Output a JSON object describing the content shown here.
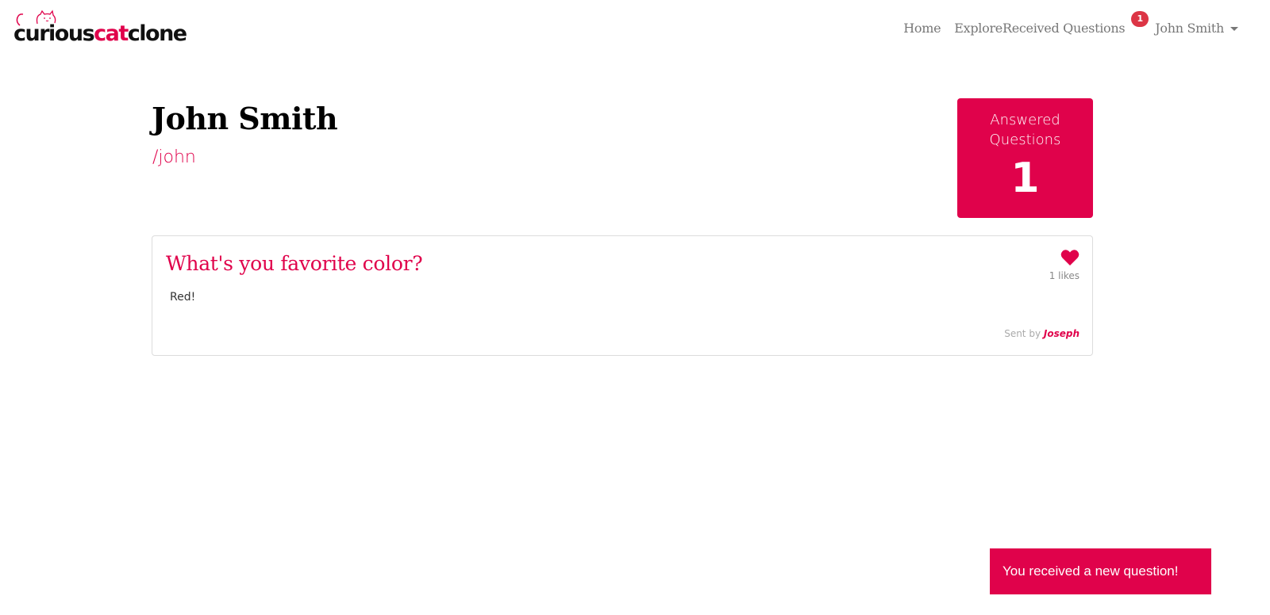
{
  "brand": {
    "part1": "curious",
    "part2": "cat",
    "part3": "clone",
    "accent_color": "#e0024b"
  },
  "nav": {
    "home": "Home",
    "explore": "Explore",
    "received_questions": "Received Questions",
    "received_badge": "1",
    "user_name": "John Smith"
  },
  "profile": {
    "name": "John Smith",
    "handle": "/john"
  },
  "stats": {
    "label": "Answered Questions",
    "value": "1"
  },
  "question": {
    "title": "What's you favorite color?",
    "answer": "Red!",
    "likes_text": "1 likes",
    "sent_by_prefix": "Sent by",
    "sender": "Joseph",
    "like_icon": "heart-icon"
  },
  "toast": {
    "message": "You received a new question!"
  }
}
